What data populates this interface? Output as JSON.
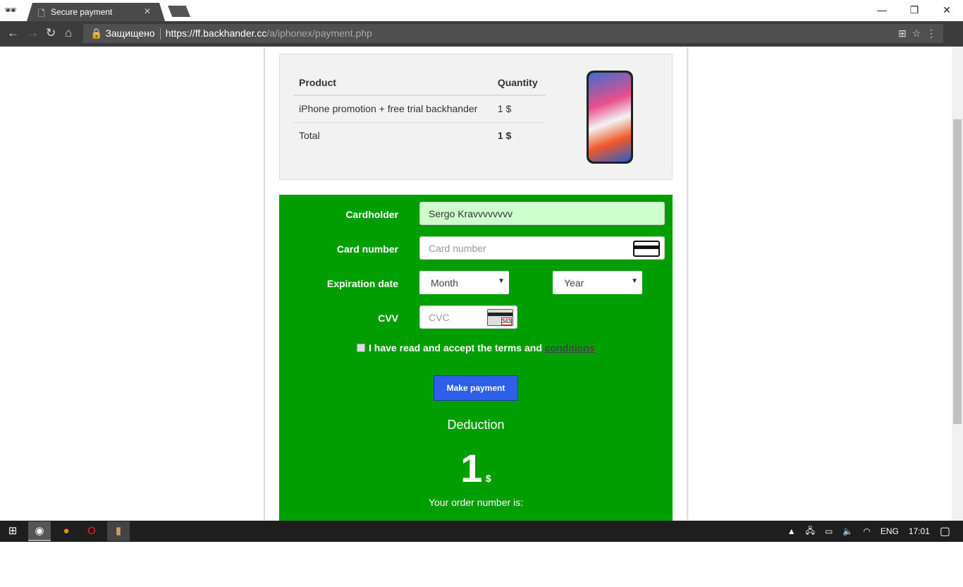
{
  "browser": {
    "tab_title": "Secure payment",
    "security_label": "Защищено",
    "url_host": "https://ff.backhander.cc",
    "url_path": "/a/iphonex/payment.php"
  },
  "summary": {
    "headers": [
      "Product",
      "Quantity"
    ],
    "rows": [
      [
        "iPhone promotion + free trial backhander",
        "1 $"
      ],
      [
        "Total",
        "1 $"
      ]
    ]
  },
  "form": {
    "bg_color": "#009e00",
    "cardholder_label": "Cardholder",
    "cardholder_value": "Sergo Kravvvvvvvv",
    "card_number_label": "Card number",
    "card_number_placeholder": "Card number",
    "expiration_label": "Expiration date",
    "month_value": "Month",
    "year_value": "Year",
    "cvv_label": "CVV",
    "cvv_placeholder": "CVC",
    "cvv_card_text": "343",
    "terms_text": "I have read and accept the terms and",
    "terms_link": "conditions",
    "pay_button": "Make payment",
    "pay_color": "#2f5fe8",
    "deduction_label": "Deduction",
    "deduction_amount": "1",
    "deduction_currency": "$",
    "order_label": "Your order number is:"
  },
  "taskbar": {
    "lang": "ENG",
    "time": "17:01"
  }
}
